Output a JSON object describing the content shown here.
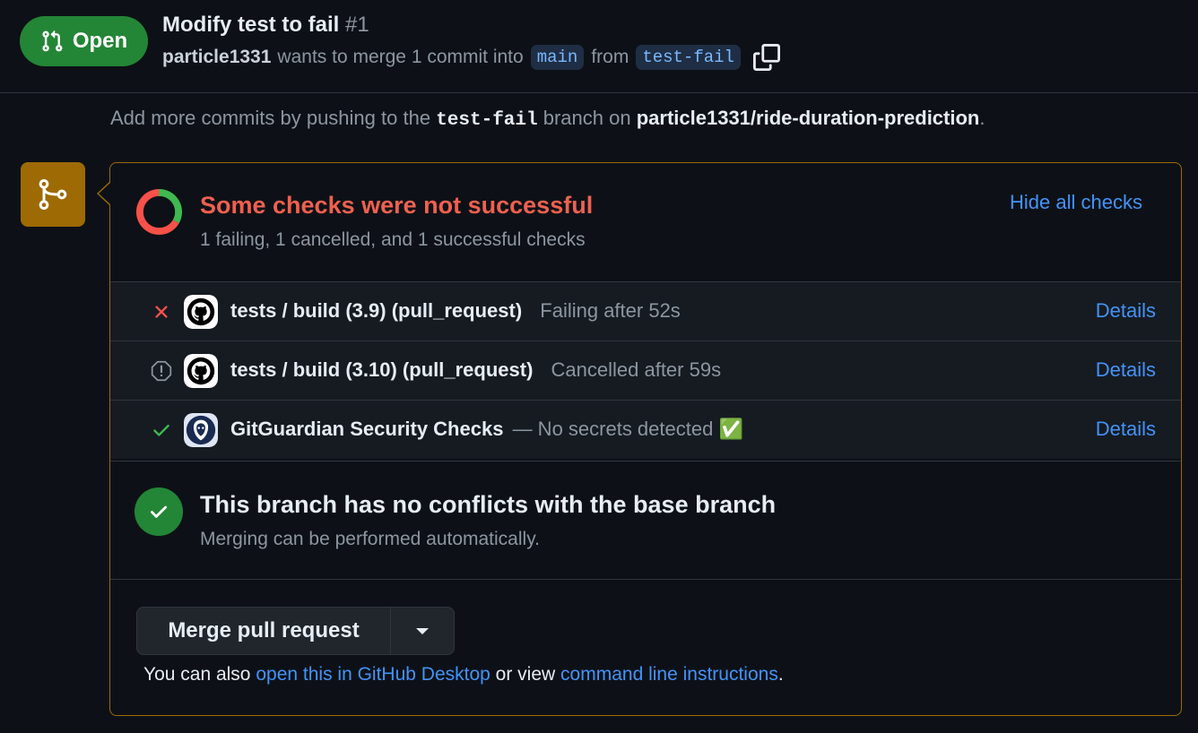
{
  "header": {
    "state_label": "Open",
    "title": "Modify test to fail",
    "number": "#1",
    "author": "particle1331",
    "meta_text": "wants to merge 1 commit into",
    "base_branch": "main",
    "from_text": "from",
    "head_branch": "test-fail",
    "state_color": "#238636"
  },
  "hint": {
    "prefix": "Add more commits by pushing to the",
    "branch": "test-fail",
    "middle": "branch on",
    "repo": "particle1331/ride-duration-prediction",
    "suffix": "."
  },
  "checks": {
    "title": "Some checks were not successful",
    "summary": "1 failing, 1 cancelled, and 1 successful checks",
    "hide_label": "Hide all checks",
    "donut": {
      "failing": 1,
      "cancelled": 1,
      "successful": 1
    },
    "items": [
      {
        "status": "failing",
        "status_icon": "x-icon",
        "app_icon": "github-icon",
        "name": "tests / build (3.9) (pull_request)",
        "desc": "Failing after 52s",
        "details": "Details"
      },
      {
        "status": "cancelled",
        "status_icon": "stop-icon",
        "app_icon": "github-icon",
        "name": "tests / build (3.10) (pull_request)",
        "desc": "Cancelled after 59s",
        "details": "Details"
      },
      {
        "status": "success",
        "status_icon": "check-icon",
        "app_icon": "gitguardian-icon",
        "name": "GitGuardian Security Checks",
        "desc": "— No secrets detected ✅",
        "details": "Details"
      }
    ],
    "colors": {
      "fail": "#f85149",
      "warn": "#9e6a03",
      "success": "#3fb950"
    }
  },
  "merge": {
    "title": "This branch has no conflicts with the base branch",
    "subtitle": "Merging can be performed automatically.",
    "button_label": "Merge pull request",
    "also_prefix": "You can also",
    "desktop_link": "open this in GitHub Desktop",
    "also_middle": "or view",
    "cli_link": "command line instructions",
    "also_suffix": "."
  }
}
